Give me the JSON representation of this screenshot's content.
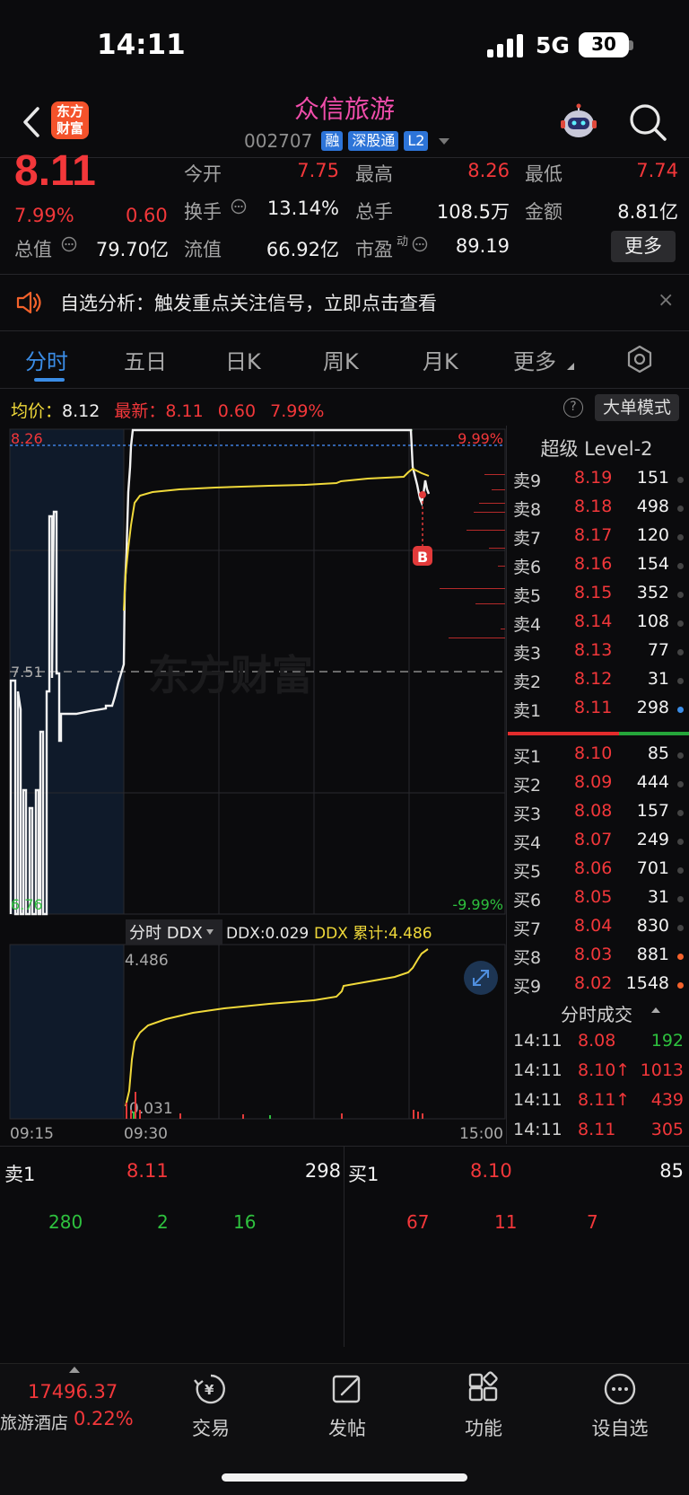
{
  "status_bar": {
    "time": "14:11",
    "network": "5G",
    "battery": "30"
  },
  "header": {
    "logo_line1": "东方",
    "logo_line2": "财富",
    "stock_name": "众信旅游",
    "stock_code": "002707",
    "tags": [
      "融",
      "深股通",
      "L2"
    ]
  },
  "quote": {
    "last_price": "8.11",
    "change_pct": "7.99%",
    "change": "0.60",
    "fields": [
      {
        "label": "今开",
        "value": "7.75",
        "color": "red"
      },
      {
        "label": "最高",
        "value": "8.26",
        "color": "red"
      },
      {
        "label": "最低",
        "value": "7.74",
        "color": "red"
      },
      {
        "label": "换手",
        "value": "13.14%",
        "color": "white"
      },
      {
        "label": "总手",
        "value": "108.5万",
        "color": "white"
      },
      {
        "label": "金额",
        "value": "8.81亿",
        "color": "white"
      },
      {
        "label": "总值",
        "value": "79.70亿",
        "color": "white"
      },
      {
        "label": "流值",
        "value": "66.92亿",
        "color": "white"
      },
      {
        "label": "市盈",
        "value": "89.19",
        "color": "white",
        "sup": "动"
      }
    ],
    "more_label": "更多"
  },
  "notice": {
    "text": "自选分析：触发重点关注信号，立即点击查看",
    "close": "×"
  },
  "tabs": [
    {
      "label": "分时",
      "active": true
    },
    {
      "label": "五日"
    },
    {
      "label": "日K"
    },
    {
      "label": "周K"
    },
    {
      "label": "月K"
    },
    {
      "label": "更多"
    }
  ],
  "info_line": {
    "avg_label": "均价：",
    "avg_value": "8.12",
    "latest_label": "最新：",
    "latest_value": "8.11",
    "latest_chg": "0.60",
    "latest_pct": "7.99%",
    "help": "?",
    "big_order_mode": "大单模式"
  },
  "chart_data": {
    "type": "line",
    "price_axis": {
      "top": "8.26",
      "mid": "7.51",
      "bottom": "6.76",
      "top_pct": "9.99%",
      "bottom_pct": "-9.99%"
    },
    "watermark": "东方财富",
    "marker": "B",
    "ddx": {
      "label": "分时 DDX",
      "ddx_text": "DDX:0.029",
      "ddx_cum_text": "DDX 累计:4.486",
      "axis_top": "4.486",
      "axis_bottom": "0.031"
    },
    "time_axis": [
      "09:15",
      "09:30",
      "15:00"
    ],
    "series": [
      {
        "values": [
          7.51,
          7.1,
          6.82,
          7.0,
          6.9,
          7.4,
          7.82,
          7.0,
          7.48,
          7.51,
          7.52,
          7.53,
          7.56,
          7.6,
          8.26,
          8.26,
          8.26,
          8.26,
          8.26,
          8.26,
          8.26,
          8.26,
          8.16,
          8.11
        ]
      },
      {
        "values": [
          7.54,
          7.7,
          8.0,
          8.06,
          8.08,
          8.09,
          8.1,
          8.1,
          8.11,
          8.11,
          8.12,
          8.12,
          8.14,
          8.12
        ]
      },
      {
        "values": [
          0.03,
          1.2,
          1.6,
          1.8,
          1.95,
          2.05,
          2.15,
          2.25,
          2.35,
          2.45,
          2.55,
          2.7,
          2.9,
          3.2,
          3.4,
          3.6,
          3.8,
          4.1,
          4.486
        ]
      }
    ]
  },
  "level2": {
    "title": "超级 Level-2",
    "asks": [
      {
        "side": "卖9",
        "price": "8.19",
        "vol": "151"
      },
      {
        "side": "卖8",
        "price": "8.18",
        "vol": "498"
      },
      {
        "side": "卖7",
        "price": "8.17",
        "vol": "120"
      },
      {
        "side": "卖6",
        "price": "8.16",
        "vol": "154"
      },
      {
        "side": "卖5",
        "price": "8.15",
        "vol": "352"
      },
      {
        "side": "卖4",
        "price": "8.14",
        "vol": "108"
      },
      {
        "side": "卖3",
        "price": "8.13",
        "vol": "77"
      },
      {
        "side": "卖2",
        "price": "8.12",
        "vol": "31"
      },
      {
        "side": "卖1",
        "price": "8.11",
        "vol": "298"
      }
    ],
    "bids": [
      {
        "side": "买1",
        "price": "8.10",
        "vol": "85"
      },
      {
        "side": "买2",
        "price": "8.09",
        "vol": "444"
      },
      {
        "side": "买3",
        "price": "8.08",
        "vol": "157"
      },
      {
        "side": "买4",
        "price": "8.07",
        "vol": "249"
      },
      {
        "side": "买5",
        "price": "8.06",
        "vol": "701"
      },
      {
        "side": "买6",
        "price": "8.05",
        "vol": "31"
      },
      {
        "side": "买7",
        "price": "8.04",
        "vol": "830"
      },
      {
        "side": "买8",
        "price": "8.03",
        "vol": "881"
      },
      {
        "side": "买9",
        "price": "8.02",
        "vol": "1548"
      }
    ],
    "trades_title": "分时成交",
    "trades": [
      {
        "time": "14:11",
        "price": "8.08",
        "vol": "192",
        "color": "green"
      },
      {
        "time": "14:11",
        "price": "8.10↑",
        "vol": "1013",
        "color": "red"
      },
      {
        "time": "14:11",
        "price": "8.11↑",
        "vol": "439",
        "color": "red"
      },
      {
        "time": "14:11",
        "price": "8.11",
        "vol": "305",
        "color": "red"
      }
    ]
  },
  "bottom_quote": {
    "ask_label": "卖1",
    "ask_price": "8.11",
    "ask_vol": "298",
    "bid_label": "买1",
    "bid_price": "8.10",
    "bid_vol": "85",
    "ask_queue": [
      "280",
      "2",
      "16"
    ],
    "bid_queue": [
      "67",
      "11",
      "7"
    ]
  },
  "bottom_nav": {
    "index_value": "17496.37",
    "index_name": "旅游酒店",
    "index_pct": "0.22%",
    "items": [
      {
        "label": "交易",
        "icon": "trade-icon"
      },
      {
        "label": "发帖",
        "icon": "post-icon"
      },
      {
        "label": "功能",
        "icon": "function-icon"
      },
      {
        "label": "设自选",
        "icon": "add-watchlist-icon"
      }
    ]
  }
}
